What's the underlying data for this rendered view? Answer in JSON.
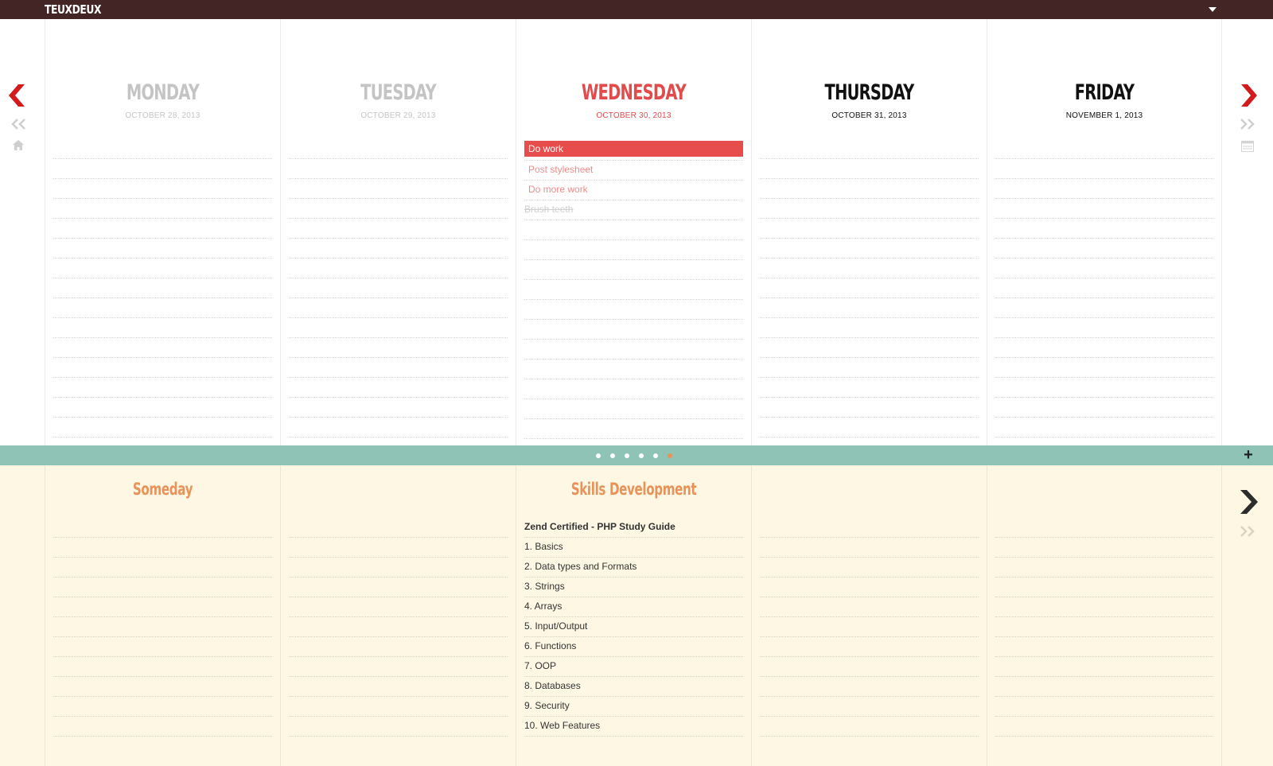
{
  "app": {
    "brand": "TEUXDEUX"
  },
  "days": [
    {
      "name": "MONDAY",
      "date": "OCTOBER 28, 2013",
      "state": "past",
      "tasks": []
    },
    {
      "name": "TUESDAY",
      "date": "OCTOBER 29, 2013",
      "state": "past",
      "tasks": []
    },
    {
      "name": "WEDNESDAY",
      "date": "OCTOBER 30, 2013",
      "state": "today",
      "tasks": [
        {
          "text": "Do work",
          "style": "active"
        },
        {
          "text": "Post stylesheet",
          "style": "pink"
        },
        {
          "text": "Do more work",
          "style": "pink"
        },
        {
          "text": "Brush teeth",
          "style": "done"
        }
      ]
    },
    {
      "name": "THURSDAY",
      "date": "OCTOBER 31, 2013",
      "state": "future",
      "tasks": []
    },
    {
      "name": "FRIDAY",
      "date": "NOVEMBER 1, 2013",
      "state": "future",
      "tasks": []
    }
  ],
  "lists": [
    {
      "title": "Someday",
      "items": []
    },
    {
      "title": "",
      "items": []
    },
    {
      "title": "Skills Development",
      "items": [
        {
          "text": "Zend Certified - PHP Study Guide",
          "style": "bold"
        },
        {
          "text": "1. Basics",
          "style": "plain"
        },
        {
          "text": "2. Data types and Formats",
          "style": "plain"
        },
        {
          "text": "3. Strings",
          "style": "plain"
        },
        {
          "text": "4. Arrays",
          "style": "plain"
        },
        {
          "text": "5. Input/Output",
          "style": "plain"
        },
        {
          "text": "6. Functions",
          "style": "plain"
        },
        {
          "text": "7. OOP",
          "style": "plain"
        },
        {
          "text": "8. Databases",
          "style": "plain"
        },
        {
          "text": "9. Security",
          "style": "plain"
        },
        {
          "text": "10. Web Features",
          "style": "plain"
        }
      ]
    },
    {
      "title": "",
      "items": []
    },
    {
      "title": "",
      "items": []
    }
  ],
  "pager": {
    "count": 6,
    "active_index": 5
  },
  "add_list_label": "+",
  "colors": {
    "topbar": "#432526",
    "today": "#e24b4b",
    "active_task": "#e84d4d",
    "divider": "#8ec3b6",
    "list_title": "#e8935a",
    "lower_bg": "#fdf7e4"
  },
  "icons": {
    "prev_day": "chevron-left-icon",
    "prev_week": "double-chevron-left-icon",
    "home": "home-icon",
    "next_day": "chevron-right-icon",
    "next_week": "double-chevron-right-icon",
    "calendar": "calendar-icon",
    "next_list": "chevron-right-icon",
    "next_lists": "double-chevron-right-icon"
  }
}
